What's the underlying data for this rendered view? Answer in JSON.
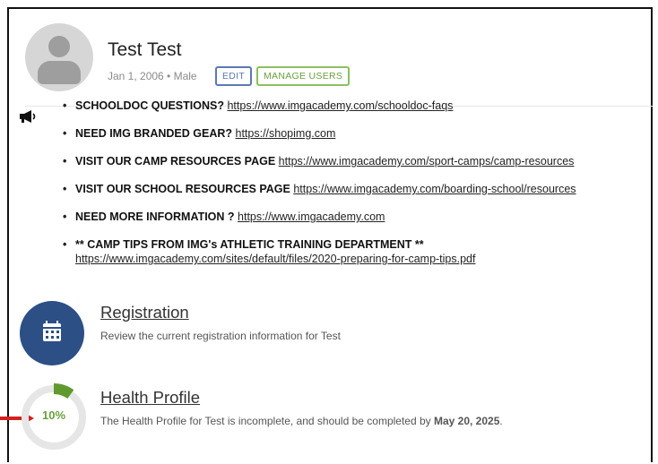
{
  "profile": {
    "name": "Test Test",
    "meta": "Jan 1, 2006 • Male",
    "edit_label": "EDIT",
    "manage_label": "MANAGE USERS"
  },
  "announcements": [
    {
      "label": "SCHOOLDOC QUESTIONS?",
      "link": "https://www.imgacademy.com/schooldoc-faqs"
    },
    {
      "label": "NEED IMG BRANDED GEAR?",
      "link": "https://shopimg.com"
    },
    {
      "label": "VISIT OUR CAMP RESOURCES PAGE",
      "link": "https://www.imgacademy.com/sport-camps/camp-resources"
    },
    {
      "label": "VISIT OUR SCHOOL RESOURCES PAGE",
      "link": "https://www.imgacademy.com/boarding-school/resources"
    },
    {
      "label": "NEED MORE INFORMATION ?",
      "link": "https://www.imgacademy.com"
    },
    {
      "label": "** CAMP TIPS FROM IMG's ATHLETIC TRAINING DEPARTMENT **",
      "link": "https://www.imgacademy.com/sites/default/files/2020-preparing-for-camp-tips.pdf"
    }
  ],
  "registration": {
    "title": "Registration",
    "description": "Review the current registration information for Test"
  },
  "health": {
    "title": "Health Profile",
    "description_prefix": "The Health Profile for Test is incomplete, and should be completed by ",
    "due_date": "May 20, 2025",
    "description_suffix": ".",
    "progress_label": "10%",
    "progress": 0.1
  },
  "colors": {
    "edit": "#5b79b4",
    "manage": "#8bbf5f",
    "registration_icon_bg": "#2c4f86",
    "progress": "#5f9a2e",
    "progress_track": "#e6e6e6",
    "arrow": "#d32020"
  }
}
